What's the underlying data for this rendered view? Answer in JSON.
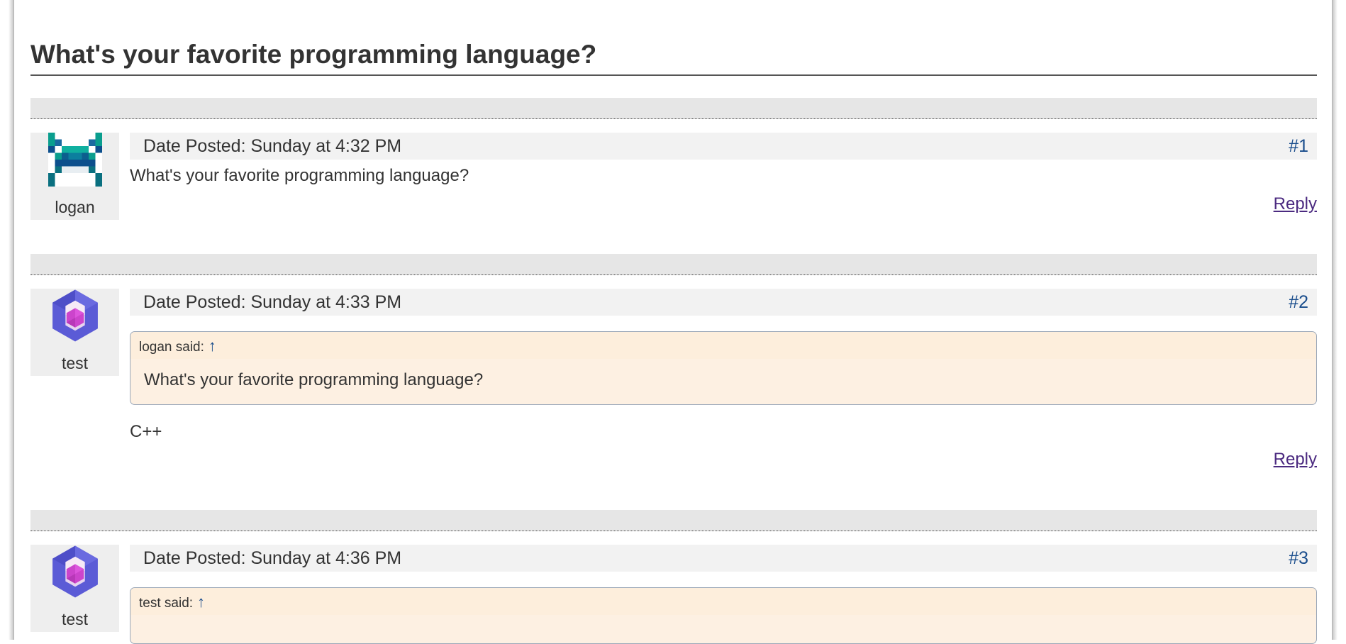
{
  "thread": {
    "title": "What's your favorite programming language?"
  },
  "posts": [
    {
      "username": "logan",
      "avatar_icon": "identicon-teal-avatar",
      "date": "Date Posted: Sunday at 4:32 PM",
      "number": "#1",
      "body": "What's your favorite programming language?",
      "reply": "Reply"
    },
    {
      "username": "test",
      "avatar_icon": "identicon-hexagon-avatar",
      "date": "Date Posted: Sunday at 4:33 PM",
      "number": "#2",
      "quote": {
        "author": "logan said:",
        "arrow": "↑",
        "text": "What's your favorite programming language?"
      },
      "body": "C++",
      "reply": "Reply"
    },
    {
      "username": "test",
      "avatar_icon": "identicon-hexagon-avatar",
      "date": "Date Posted: Sunday at 4:36 PM",
      "number": "#3",
      "quote": {
        "author": "test said:",
        "arrow": "↑"
      }
    }
  ],
  "colors": {
    "text": "#333333",
    "link": "#1a4d8c",
    "reply_link": "#4b2a80",
    "quote_bg": "#fdf0e2",
    "header_bg": "#f2f2f2",
    "separator_bg": "#e6e6e6"
  }
}
